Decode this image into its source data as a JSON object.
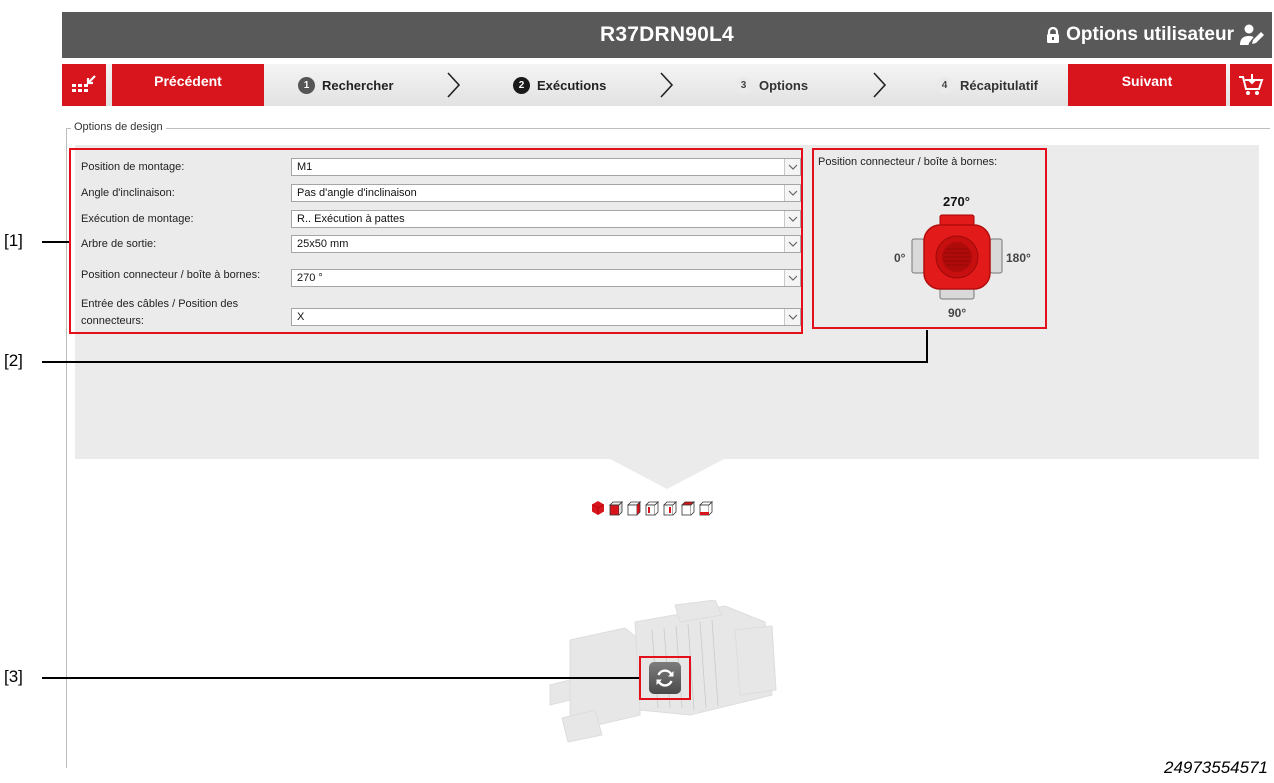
{
  "header": {
    "title": "R37DRN90L4",
    "user_options_label": "Options utilisateur"
  },
  "nav": {
    "prev_label": "Précédent",
    "next_label": "Suivant",
    "steps": [
      {
        "number": "1",
        "label": "Rechercher"
      },
      {
        "number": "2",
        "label": "Exécutions"
      },
      {
        "number": "3",
        "label": "Options"
      },
      {
        "number": "4",
        "label": "Récapitulatif"
      }
    ],
    "active_step": 2
  },
  "design": {
    "legend": "Options de design",
    "fields": [
      {
        "label": "Position de montage:",
        "value": "M1"
      },
      {
        "label": "Angle d'inclinaison:",
        "value": "Pas d'angle d'inclinaison"
      },
      {
        "label": "Exécution de montage:",
        "value": "R.. Exécution à pattes"
      },
      {
        "label": "Arbre de sortie:",
        "value": "25x50 mm"
      },
      {
        "label": "Position connecteur / boîte à bornes:",
        "value": "270 °"
      },
      {
        "label": "Entrée des câbles / Position des connecteurs:",
        "value": "X"
      }
    ]
  },
  "connector_panel": {
    "title": "Position connecteur / boîte à bornes:",
    "top": "270°",
    "left": "0°",
    "right": "180°",
    "bottom": "90°"
  },
  "callouts": [
    "[1]",
    "[2]",
    "[3]"
  ],
  "figure_id": "24973554571",
  "colors": {
    "accent": "#d8141d",
    "header_bg": "#595959",
    "panel_bg": "#ebebeb"
  }
}
